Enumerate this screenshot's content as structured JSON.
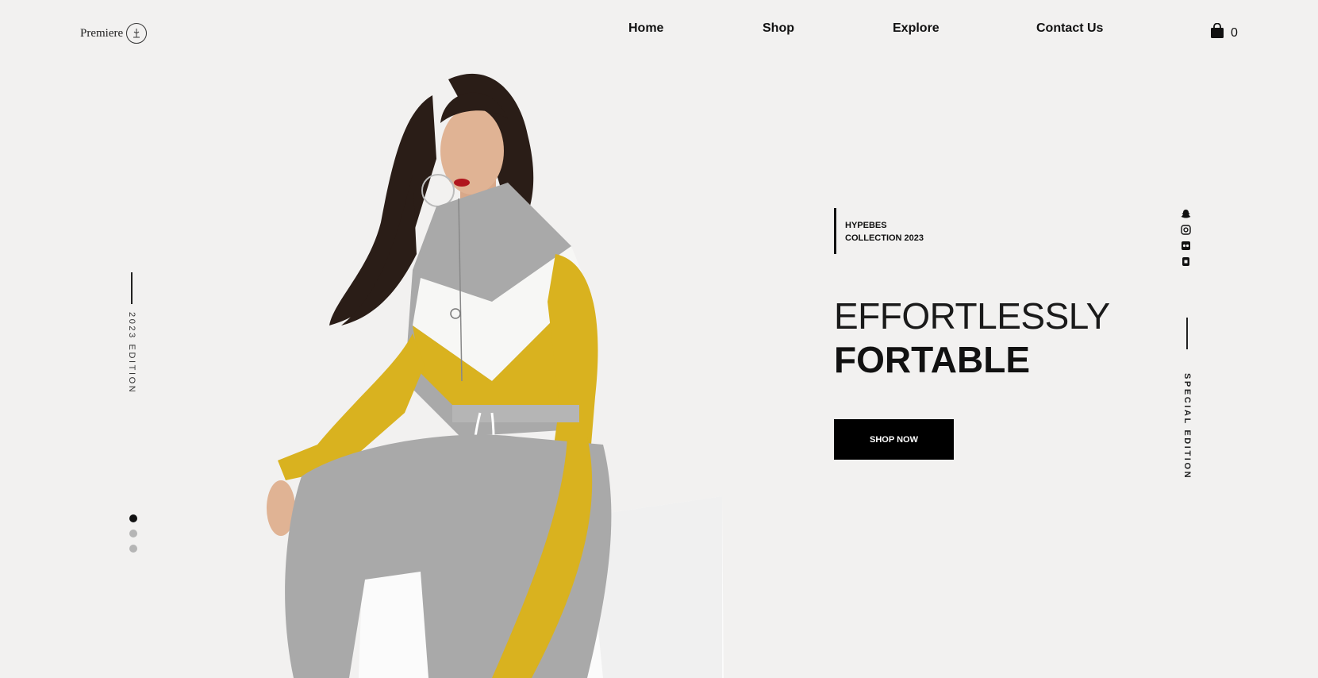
{
  "brand": {
    "name": "Premiere"
  },
  "nav": {
    "items": [
      {
        "label": "Home"
      },
      {
        "label": "Shop"
      },
      {
        "label": "Explore"
      },
      {
        "label": "Contact Us"
      }
    ]
  },
  "cart": {
    "count": "0",
    "icon": "shopping-bag-icon"
  },
  "left_rail": {
    "text": "2023 EDITION"
  },
  "slider": {
    "total": 3,
    "active_index": 0
  },
  "hero": {
    "tag_line_1": "HYPEBES",
    "tag_line_2": "COLLECTION 2023",
    "headline_light": "EFFORTLESSLY",
    "headline_bold": "FORTABLE",
    "cta_label": "SHOP NOW"
  },
  "socials": [
    {
      "icon": "snapchat-icon"
    },
    {
      "icon": "instagram-icon"
    },
    {
      "icon": "flickr-icon"
    },
    {
      "icon": "video-icon"
    }
  ],
  "right_rail": {
    "text": "SPECIAL EDITION"
  },
  "colors": {
    "background": "#f2f1f0",
    "accent_yellow": "#d9b21f",
    "fabric_gray": "#a9a9a9",
    "button": "#000000"
  }
}
